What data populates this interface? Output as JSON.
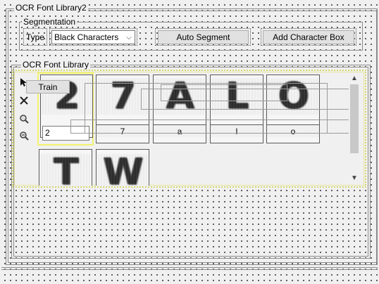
{
  "window": {
    "title": "OCR Font Library2"
  },
  "segmentation": {
    "title": "Segmentation",
    "type_label": "Type",
    "type_value": "Black Characters",
    "auto_segment_label": "Auto Segment",
    "add_box_label": "Add Character Box"
  },
  "library": {
    "title": "OCR Font Library",
    "train_label": "Train",
    "selected_input_value": "2",
    "characters": [
      {
        "glyph": "2",
        "label": "2"
      },
      {
        "glyph": "7",
        "label": "7"
      },
      {
        "glyph": "A",
        "label": "a"
      },
      {
        "glyph": "L",
        "label": "l"
      },
      {
        "glyph": "O",
        "label": "o"
      },
      {
        "glyph": "T",
        "label": ""
      },
      {
        "glyph": "W",
        "label": ""
      }
    ]
  },
  "icons": {
    "scroll_up": "▲",
    "scroll_down": "▼",
    "select_chevron": "⌵"
  }
}
